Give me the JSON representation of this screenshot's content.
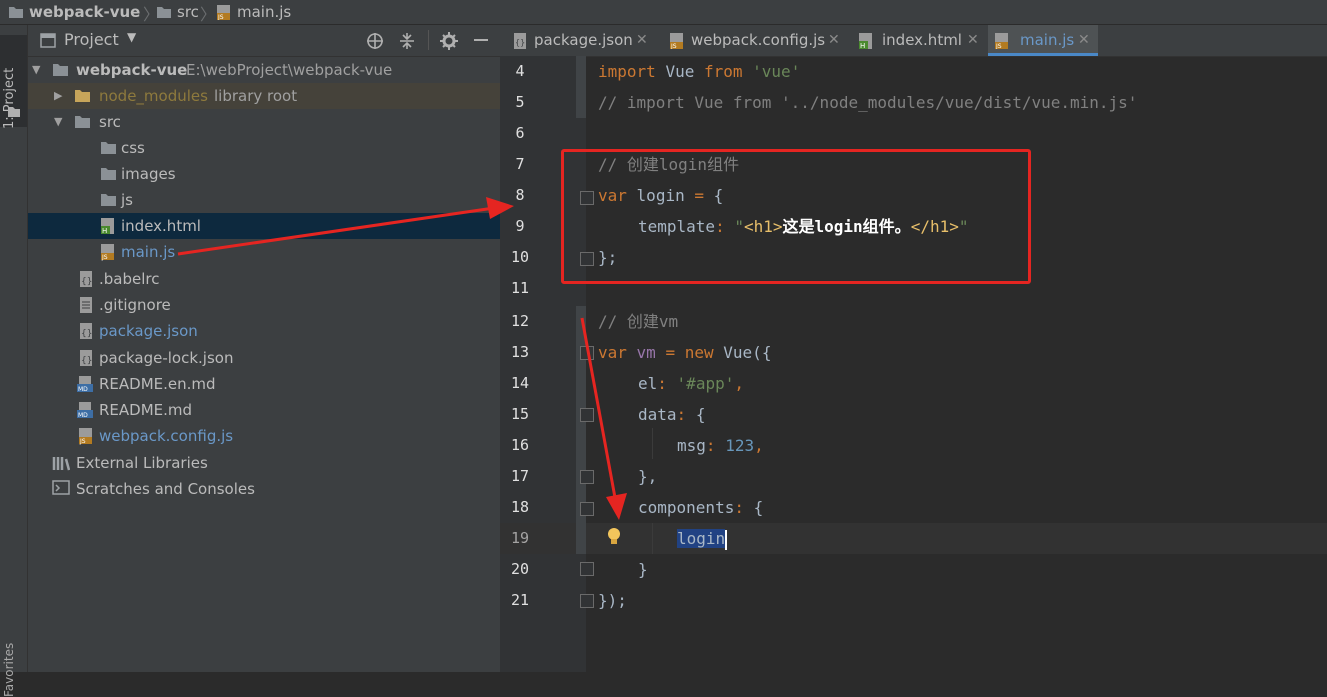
{
  "breadcrumb": {
    "project": "webpack-vue",
    "folder": "src",
    "file": "main.js"
  },
  "stripe": {
    "label": "1: Project",
    "bottom_label": "Favorites"
  },
  "project_panel": {
    "view_label": "Project",
    "root": {
      "name": "webpack-vue",
      "path": "E:\\webProject\\webpack-vue"
    },
    "node_modules": {
      "name": "node_modules",
      "suffix": "library root"
    },
    "src": "src",
    "folders": [
      "css",
      "images",
      "js"
    ],
    "files_src": [
      "index.html",
      "main.js"
    ],
    "files_root": [
      ".babelrc",
      ".gitignore",
      "package.json",
      "package-lock.json",
      "README.en.md",
      "README.md",
      "webpack.config.js"
    ],
    "external": "External Libraries",
    "scratches": "Scratches and Consoles"
  },
  "tabs": [
    {
      "label": "package.json"
    },
    {
      "label": "webpack.config.js"
    },
    {
      "label": "index.html"
    },
    {
      "label": "main.js",
      "active": true
    }
  ],
  "code": {
    "line_numbers": [
      "4",
      "5",
      "6",
      "7",
      "8",
      "9",
      "10",
      "11",
      "12",
      "13",
      "14",
      "15",
      "16",
      "17",
      "18",
      "19",
      "20",
      "21"
    ],
    "l4": {
      "kw_import": "import",
      "name": "Vue",
      "kw_from": "from",
      "str": "'vue'"
    },
    "l5": "// import Vue from '../node_modules/vue/dist/vue.min.js'",
    "l7": "// 创建login组件",
    "l8": {
      "kw": "var",
      "rest": "login",
      "op": "=",
      "brace": "{"
    },
    "l9": {
      "key": "template",
      "colon": ":",
      "q1": "\"",
      "t1": "<h1>",
      "text": "这是login组件。",
      "t2": "</h1>",
      "q2": "\""
    },
    "l10": "};",
    "l12": "// 创建vm",
    "l13": {
      "kw": "var",
      "name": "vm",
      "op": "=",
      "kw_new": "new",
      "ctor": "Vue({"
    },
    "l14": {
      "key": "el",
      "colon": ":",
      "str": "'#app'",
      "tail": ","
    },
    "l15": {
      "key": "data",
      "colon": ":",
      "brace": "{"
    },
    "l16": {
      "key": "msg",
      "colon": ":",
      "num": "123",
      "tail": ","
    },
    "l17": "},",
    "l18": {
      "key": "components",
      "colon": ":",
      "brace": "{"
    },
    "l19": "login",
    "l20": "}",
    "l21": "});"
  },
  "colors": {
    "annotation": "#e52521",
    "selected_row": "#0d293e",
    "current_line": "#323232"
  }
}
